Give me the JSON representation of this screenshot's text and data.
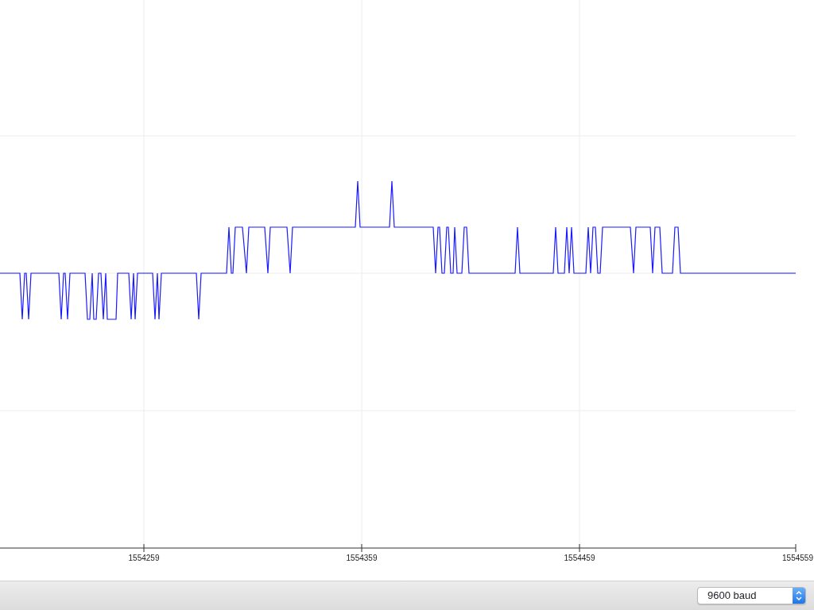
{
  "plot": {
    "x_tick_labels": [
      "1554259",
      "1554359",
      "1554459",
      "1554559"
    ]
  },
  "status_bar": {
    "baud_rate": "9600 baud"
  }
}
